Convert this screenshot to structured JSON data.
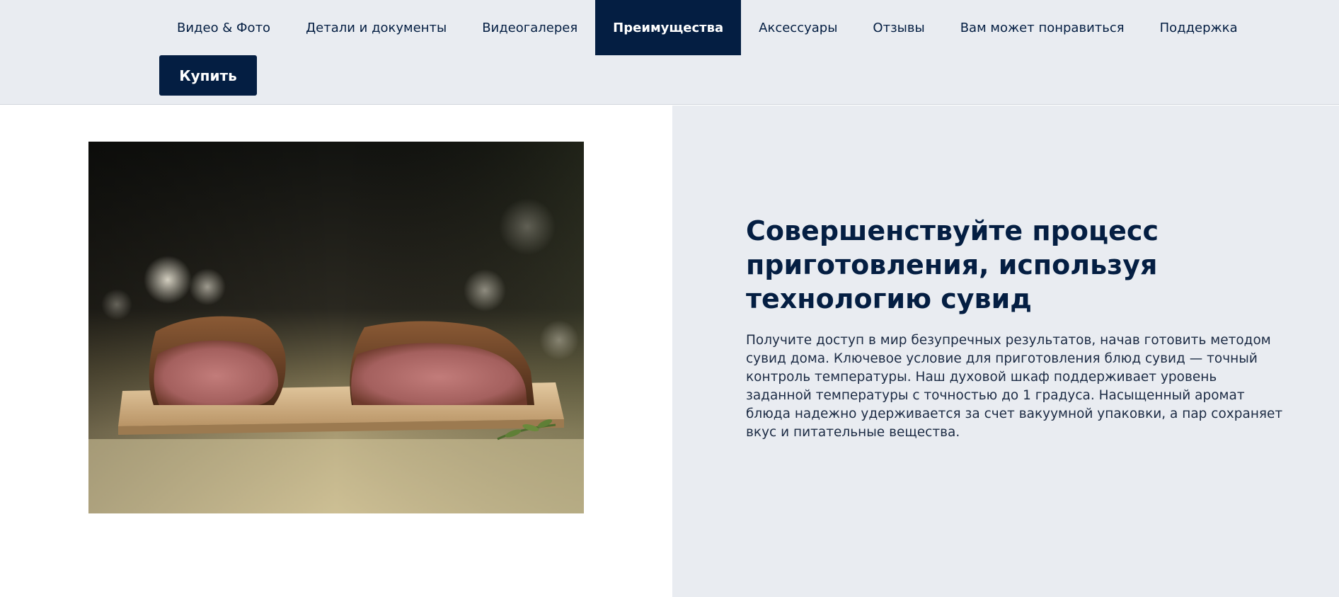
{
  "nav": {
    "tabs": [
      {
        "label": "Видео & Фото",
        "active": false
      },
      {
        "label": "Детали и документы",
        "active": false
      },
      {
        "label": "Видеогалерея",
        "active": false
      },
      {
        "label": "Преимущества",
        "active": true
      },
      {
        "label": "Аксессуары",
        "active": false
      },
      {
        "label": "Отзывы",
        "active": false
      },
      {
        "label": "Вам может понравиться",
        "active": false
      },
      {
        "label": "Поддержка",
        "active": false
      }
    ],
    "buy_label": "Купить"
  },
  "feature": {
    "title": "Совершенствуйте процесс приготовления, используя технологию сувид",
    "description": "Получите доступ в мир безупречных результатов, начав готовить методом сувид дома. Ключевое условие для приготовления блюд сувид — точный контроль температуры. Наш духовой шкаф поддерживает уровень заданной температуры с точностью до 1 градуса. Насыщенный аромат блюда надежно удерживается за счет вакуумной упаковки, а пар сохраняет вкус и питательные вещества."
  },
  "colors": {
    "brand_navy": "#041e42",
    "nav_bg": "#e9ecf1",
    "page_bg": "#ffffff"
  }
}
